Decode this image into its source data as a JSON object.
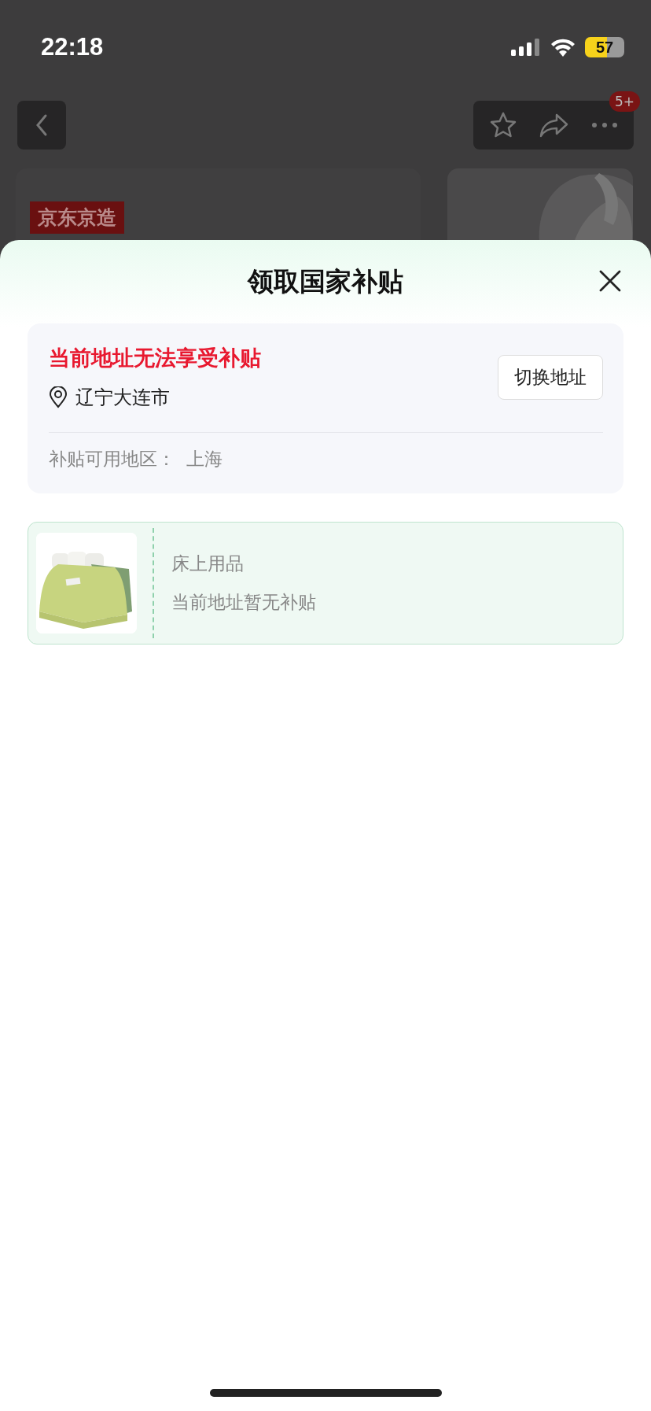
{
  "status_bar": {
    "time": "22:18",
    "battery": "57"
  },
  "nav": {
    "badge": "5+"
  },
  "background": {
    "tag": "京东京造"
  },
  "sheet": {
    "title": "领取国家补贴",
    "notice": {
      "warning": "当前地址无法享受补贴",
      "address": "辽宁大连市",
      "switch_button": "切换地址",
      "regions_label": "补贴可用地区：",
      "regions_value": "上海"
    },
    "products": [
      {
        "name": "床上用品",
        "status": "当前地址暂无补贴"
      }
    ]
  }
}
